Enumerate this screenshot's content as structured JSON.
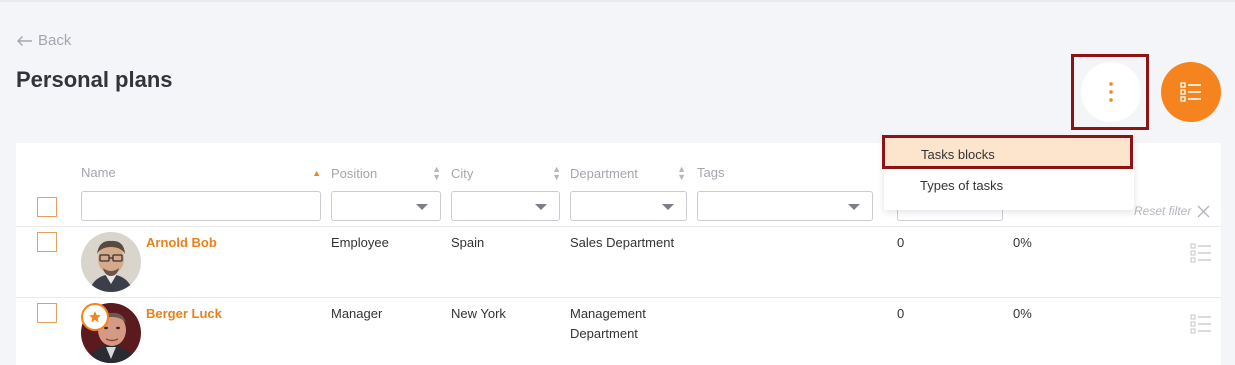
{
  "nav": {
    "back_label": "Back"
  },
  "page": {
    "title": "Personal plans"
  },
  "actions": {
    "more_icon": "kebab-vertical-icon",
    "list_icon": "list-view-icon",
    "accent": "#f5841f"
  },
  "table": {
    "columns": [
      {
        "label": "Name",
        "sort": "ascending"
      },
      {
        "label": "Position",
        "sort": "none"
      },
      {
        "label": "City",
        "sort": "none"
      },
      {
        "label": "Department",
        "sort": "none"
      },
      {
        "label": "Tags",
        "sort": "none"
      }
    ],
    "reset_filter_label": "Reset filter",
    "rows": [
      {
        "name": "Arnold Bob",
        "position": "Employee",
        "city": "Spain",
        "department": "Sales Department",
        "count": "0",
        "percent": "0%",
        "starred": false
      },
      {
        "name": "Berger Luck",
        "position": "Manager",
        "city": "New York",
        "department": "Management Department",
        "count": "0",
        "percent": "0%",
        "starred": true
      }
    ]
  },
  "dropdown": {
    "items": [
      {
        "label": "Tasks blocks",
        "highlighted": true
      },
      {
        "label": "Types of tasks",
        "highlighted": false
      }
    ]
  }
}
